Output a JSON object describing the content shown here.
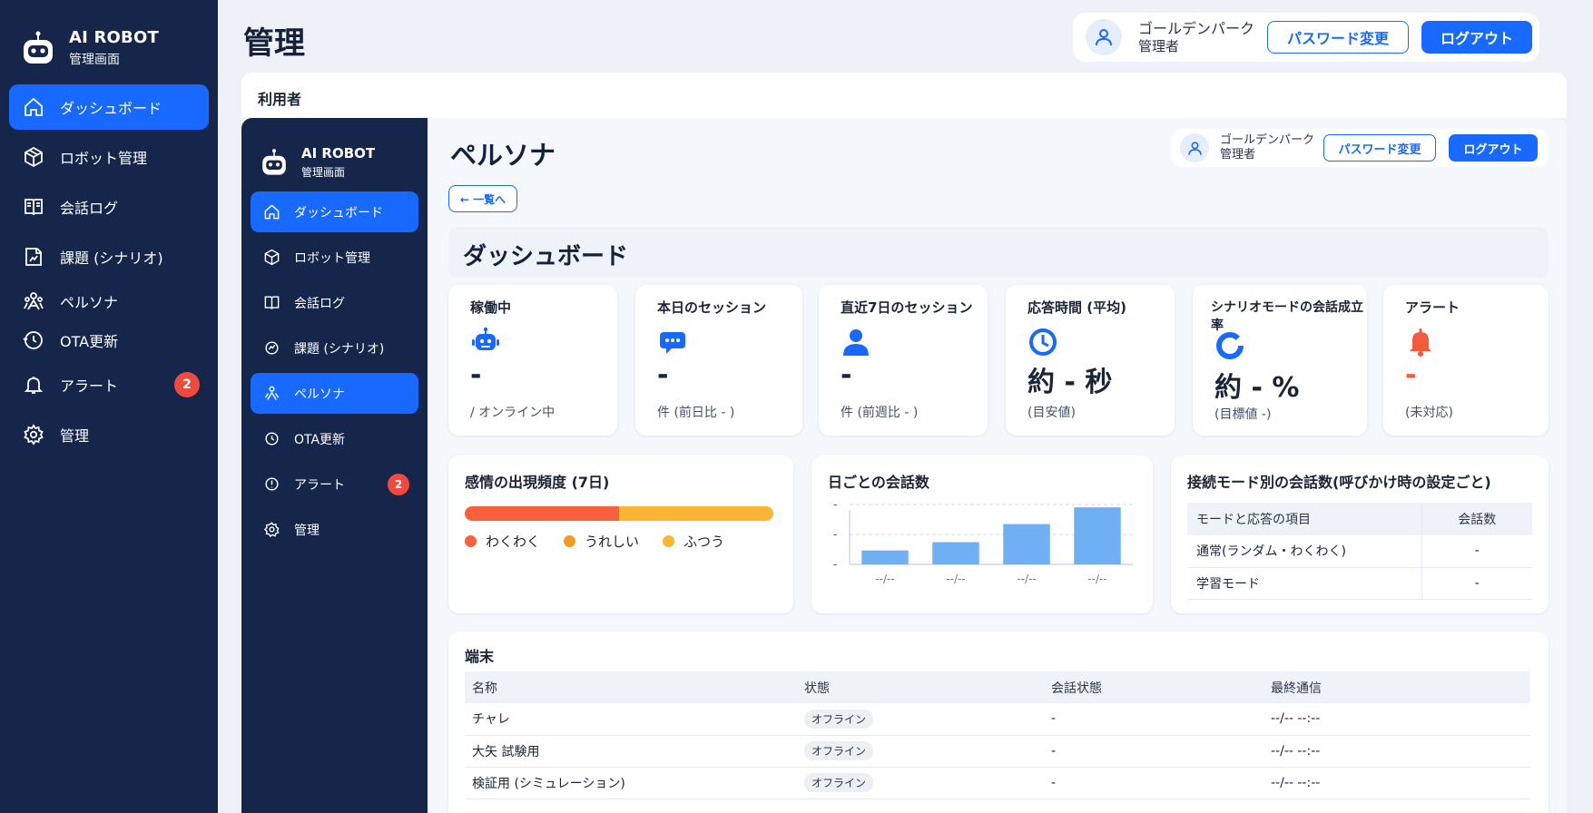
{
  "outer": {
    "brand": {
      "title": "AI ROBOT",
      "subtitle": "管理画面"
    },
    "nav": [
      {
        "label": "ダッシュボード",
        "icon": "home-icon",
        "active": true
      },
      {
        "label": "ロボット管理",
        "icon": "cube-icon"
      },
      {
        "label": "会話ログ",
        "icon": "book-icon"
      },
      {
        "label": "課題 (シナリオ)",
        "icon": "scenario-icon"
      },
      {
        "label": "ペルソナ",
        "icon": "persona-icon"
      },
      {
        "label": "OTA更新",
        "icon": "update-icon"
      },
      {
        "label": "アラート",
        "icon": "bell-icon",
        "badge": "2"
      },
      {
        "label": "管理",
        "icon": "gear-icon"
      }
    ],
    "page_title": "管理",
    "user": {
      "name": "ゴールデンパーク",
      "role": "管理者"
    },
    "change_password": "パスワード変更",
    "logout": "ログアウト",
    "section_label": "利用者"
  },
  "inner": {
    "brand": {
      "title": "AI ROBOT",
      "subtitle": "管理画面"
    },
    "nav": [
      {
        "label": "ダッシュボード",
        "icon": "home-icon",
        "active": true
      },
      {
        "label": "ロボット管理",
        "icon": "cube-icon"
      },
      {
        "label": "会話ログ",
        "icon": "book-icon"
      },
      {
        "label": "課題 (シナリオ)",
        "icon": "scenario-icon"
      },
      {
        "label": "ペルソナ",
        "icon": "persona-icon",
        "active": true
      },
      {
        "label": "OTA更新",
        "icon": "update-icon"
      },
      {
        "label": "アラート",
        "icon": "alert-icon",
        "badge": "2"
      },
      {
        "label": "管理",
        "icon": "gear-icon"
      }
    ],
    "page_title": "ペルソナ",
    "user": {
      "name": "ゴールデンパーク",
      "role": "管理者"
    },
    "change_password": "パスワード変更",
    "logout": "ログアウト",
    "back": "← 一覧へ",
    "dashboard_title": "ダッシュボード",
    "stats": [
      {
        "label": "稼働中",
        "icon": "robot-icon",
        "value": "-",
        "sub": "/ オンライン中",
        "color": "#1769ff"
      },
      {
        "label": "本日のセッション",
        "icon": "chat-icon",
        "value": "-",
        "sub": "件 (前日比 - )",
        "color": "#1769ff"
      },
      {
        "label": "直近7日のセッション",
        "icon": "person-icon",
        "value": "-",
        "sub": "件 (前週比 - )",
        "color": "#1769ff"
      },
      {
        "label": "応答時間 (平均)",
        "icon": "clock-icon",
        "value": "約 - 秒",
        "sub": "(目安値)",
        "color": "#1769ff"
      },
      {
        "label": "シナリオモードの会話成立率",
        "icon": "ring-icon",
        "value": "約 - %",
        "sub": "(目標値 -)",
        "color": "#1769ff"
      },
      {
        "label": "アラート",
        "icon": "bell-icon",
        "value": "-",
        "sub": "(未対応)",
        "color": "#f25a3c"
      }
    ],
    "emotion": {
      "title": "感情の出現頻度 (7日)",
      "segments": [
        {
          "name": "わくわく",
          "share": 0.5,
          "color": "#f9603d"
        },
        {
          "name": "うれしい",
          "share": 0.0,
          "color": "#f49a1c"
        },
        {
          "name": "ふつう",
          "share": 0.5,
          "color": "#fbb532"
        }
      ]
    },
    "daily": {
      "title": "日ごとの会話数"
    },
    "modes": {
      "title": "接続モード別の会話数(呼びかけ時の設定ごと)",
      "headers": [
        "モードと応答の項目",
        "会話数"
      ],
      "rows": [
        [
          "通常(ランダム・わくわく)",
          "-"
        ],
        [
          "学習モード",
          "-"
        ]
      ]
    },
    "devices": {
      "title": "端末",
      "headers": [
        "名称",
        "状態",
        "会話状態",
        "最終通信"
      ],
      "rows": [
        [
          "チャレ",
          "オフライン",
          "-",
          "--/-- --:--"
        ],
        [
          "大矢 試験用",
          "オフライン",
          "-",
          "--/-- --:--"
        ],
        [
          "検証用 (シミュレーション)",
          "オフライン",
          "-",
          "--/-- --:--"
        ]
      ]
    }
  },
  "chart_data": {
    "type": "bar",
    "title": "日ごとの会話数",
    "categories": [
      "--/--",
      "--/--",
      "--/--",
      "--/--"
    ],
    "values": [
      1,
      1.6,
      2.9,
      4.1
    ],
    "y_tick_labels": [
      "-",
      "-",
      "-"
    ],
    "grid": true,
    "bar_color": "#6fb0f5"
  }
}
